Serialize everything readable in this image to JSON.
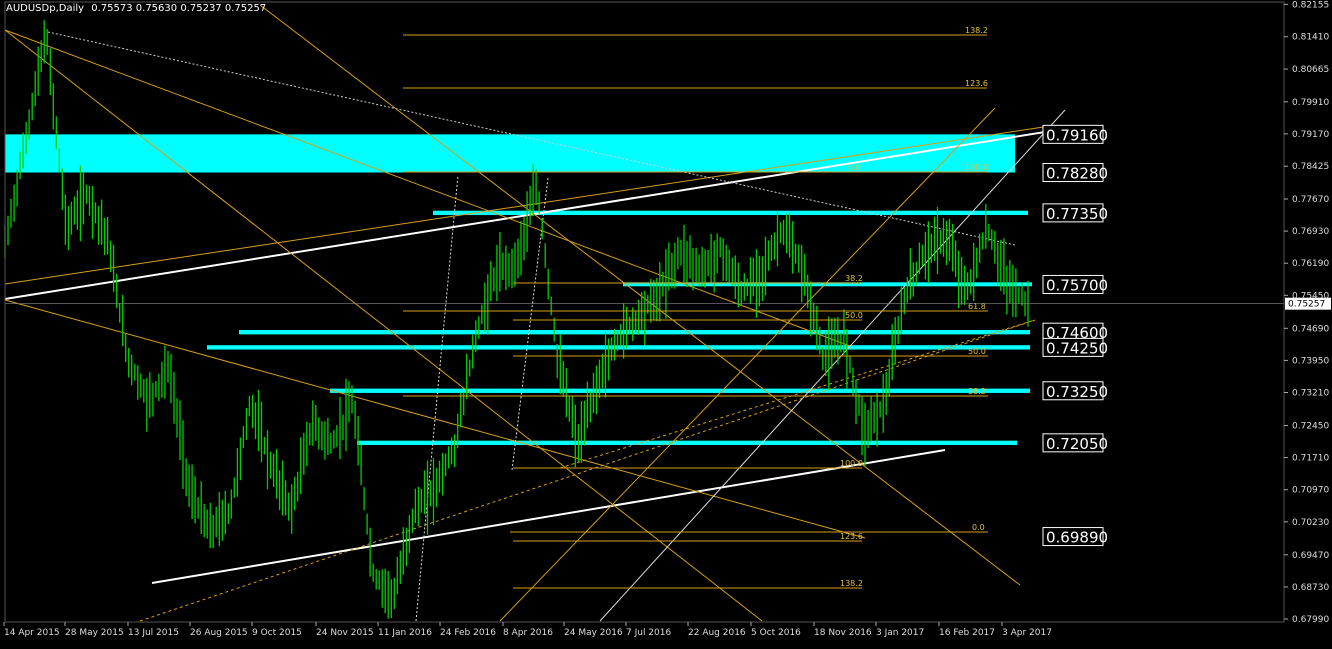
{
  "header": {
    "symbol": "AUDUSDp,Daily",
    "ohlc": "0.75573 0.75630 0.75237 0.75257"
  },
  "colors": {
    "background": "#000000",
    "candles": "#00d000",
    "zones": "#00ffff",
    "lines": "#d4a017",
    "trend": "#ffffff",
    "fib": "#d4a017"
  },
  "chart_data": {
    "type": "line",
    "title": "",
    "xlabel": "",
    "ylabel": "",
    "ylim": [
      0.6799,
      0.8221
    ],
    "x_ticks": [
      "14 Apr 2015",
      "28 May 2015",
      "13 Jul 2015",
      "26 Aug 2015",
      "9 Oct 2015",
      "24 Nov 2015",
      "11 Jan 2016",
      "24 Feb 2016",
      "8 Apr 2016",
      "24 May 2016",
      "7 Jul 2016",
      "22 Aug 2016",
      "5 Oct 2016",
      "18 Nov 2016",
      "3 Jan 2017",
      "16 Feb 2017",
      "3 Apr 2017"
    ],
    "y_ticks": [
      "0.82155",
      "0.81410",
      "0.80665",
      "0.79910",
      "0.79170",
      "0.78425",
      "0.77670",
      "0.76930",
      "0.76190",
      "0.75450",
      "0.74690",
      "0.73950",
      "0.73210",
      "0.72450",
      "0.71710",
      "0.70970",
      "0.70230",
      "0.69470",
      "0.68730",
      "0.67990"
    ],
    "current_price": "0.75257",
    "price_series": [
      {
        "date": "14 Apr 2015",
        "close": 0.766
      },
      {
        "date": "28 Apr 2015",
        "close": 0.79
      },
      {
        "date": "14 May 2015",
        "close": 0.815
      },
      {
        "date": "28 May 2015",
        "close": 0.77
      },
      {
        "date": "10 Jun 2015",
        "close": 0.778
      },
      {
        "date": "25 Jun 2015",
        "close": 0.768
      },
      {
        "date": "13 Jul 2015",
        "close": 0.74
      },
      {
        "date": "28 Jul 2015",
        "close": 0.73
      },
      {
        "date": "12 Aug 2015",
        "close": 0.738
      },
      {
        "date": "26 Aug 2015",
        "close": 0.71
      },
      {
        "date": "9 Sep 2015",
        "close": 0.7
      },
      {
        "date": "24 Sep 2015",
        "close": 0.705
      },
      {
        "date": "9 Oct 2015",
        "close": 0.73
      },
      {
        "date": "24 Oct 2015",
        "close": 0.715
      },
      {
        "date": "9 Nov 2015",
        "close": 0.705
      },
      {
        "date": "24 Nov 2015",
        "close": 0.725
      },
      {
        "date": "10 Dec 2015",
        "close": 0.72
      },
      {
        "date": "28 Dec 2015",
        "close": 0.73
      },
      {
        "date": "11 Jan 2016",
        "close": 0.69
      },
      {
        "date": "18 Jan 2016",
        "close": 0.685
      },
      {
        "date": "30 Jan 2016",
        "close": 0.705
      },
      {
        "date": "12 Feb 2016",
        "close": 0.71
      },
      {
        "date": "24 Feb 2016",
        "close": 0.72
      },
      {
        "date": "10 Mar 2016",
        "close": 0.745
      },
      {
        "date": "25 Mar 2016",
        "close": 0.76
      },
      {
        "date": "8 Apr 2016",
        "close": 0.762
      },
      {
        "date": "20 Apr 2016",
        "close": 0.78
      },
      {
        "date": "5 May 2016",
        "close": 0.74
      },
      {
        "date": "24 May 2016",
        "close": 0.72
      },
      {
        "date": "8 Jun 2016",
        "close": 0.735
      },
      {
        "date": "22 Jun 2016",
        "close": 0.745
      },
      {
        "date": "7 Jul 2016",
        "close": 0.75
      },
      {
        "date": "22 Jul 2016",
        "close": 0.755
      },
      {
        "date": "8 Aug 2016",
        "close": 0.765
      },
      {
        "date": "22 Aug 2016",
        "close": 0.76
      },
      {
        "date": "6 Sep 2016",
        "close": 0.765
      },
      {
        "date": "20 Sep 2016",
        "close": 0.755
      },
      {
        "date": "5 Oct 2016",
        "close": 0.76
      },
      {
        "date": "20 Oct 2016",
        "close": 0.77
      },
      {
        "date": "4 Nov 2016",
        "close": 0.76
      },
      {
        "date": "18 Nov 2016",
        "close": 0.74
      },
      {
        "date": "5 Dec 2016",
        "close": 0.745
      },
      {
        "date": "20 Dec 2016",
        "close": 0.723
      },
      {
        "date": "3 Jan 2017",
        "close": 0.73
      },
      {
        "date": "18 Jan 2017",
        "close": 0.755
      },
      {
        "date": "2 Feb 2017",
        "close": 0.765
      },
      {
        "date": "16 Feb 2017",
        "close": 0.768
      },
      {
        "date": "2 Mar 2017",
        "close": 0.755
      },
      {
        "date": "17 Mar 2017",
        "close": 0.77
      },
      {
        "date": "3 Apr 2017",
        "close": 0.757
      },
      {
        "date": "13 Apr 2017",
        "close": 0.7526
      }
    ],
    "levels": [
      {
        "label": "0.79160",
        "value": 0.7916
      },
      {
        "label": "0.78280",
        "value": 0.7828
      },
      {
        "label": "0.77350",
        "value": 0.7735
      },
      {
        "label": "0.75700",
        "value": 0.757
      },
      {
        "label": "0.74600",
        "value": 0.746
      },
      {
        "label": "0.74250",
        "value": 0.7425
      },
      {
        "label": "0.73250",
        "value": 0.7325
      },
      {
        "label": "0.72050",
        "value": 0.7205
      },
      {
        "label": "0.69890",
        "value": 0.6989
      }
    ],
    "fib_labels": [
      "138.2",
      "123.6",
      "100.0",
      "0.0",
      "38.2",
      "61.8",
      "50.0",
      "50.0",
      "38.2",
      "100.0",
      "0.0",
      "123.6",
      "138.2"
    ]
  }
}
